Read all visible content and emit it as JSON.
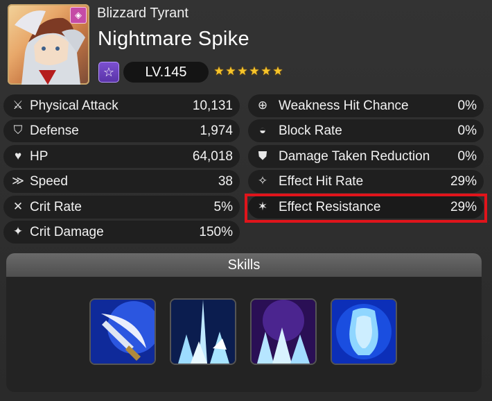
{
  "hero": {
    "subtitle": "Blizzard Tyrant",
    "name": "Nightmare Spike",
    "level": "LV.145",
    "star_count": 6,
    "class_icon": "purple-star-class-icon",
    "badge_icon": "diamond-badge-icon"
  },
  "stats_left": [
    {
      "icon": "sword-icon",
      "label": "Physical Attack",
      "value": "10,131"
    },
    {
      "icon": "shield-icon",
      "label": "Defense",
      "value": "1,974"
    },
    {
      "icon": "heart-icon",
      "label": "HP",
      "value": "64,018"
    },
    {
      "icon": "boot-icon",
      "label": "Speed",
      "value": "38"
    },
    {
      "icon": "crit-icon",
      "label": "Crit Rate",
      "value": "5%"
    },
    {
      "icon": "crit-damage-icon",
      "label": "Crit Damage",
      "value": "150%"
    }
  ],
  "stats_right": [
    {
      "icon": "crosshair-icon",
      "label": "Weakness Hit Chance",
      "value": "0%"
    },
    {
      "icon": "block-icon",
      "label": "Block Rate",
      "value": "0%"
    },
    {
      "icon": "damage-reduction-icon",
      "label": "Damage Taken Reduction",
      "value": "0%"
    },
    {
      "icon": "effect-hit-icon",
      "label": "Effect Hit Rate",
      "value": "29%"
    },
    {
      "icon": "effect-resist-icon",
      "label": "Effect Resistance",
      "value": "29%"
    }
  ],
  "skills": {
    "title": "Skills",
    "items": [
      {
        "icon": "blade-slash-skill-icon"
      },
      {
        "icon": "ice-crystal-skill-icon"
      },
      {
        "icon": "dark-ice-crystal-skill-icon"
      },
      {
        "icon": "frozen-armor-skill-icon"
      }
    ]
  },
  "colors": {
    "highlight": "#e0141b",
    "star": "#f7c52a",
    "row_bg": "#1f1f1f"
  }
}
